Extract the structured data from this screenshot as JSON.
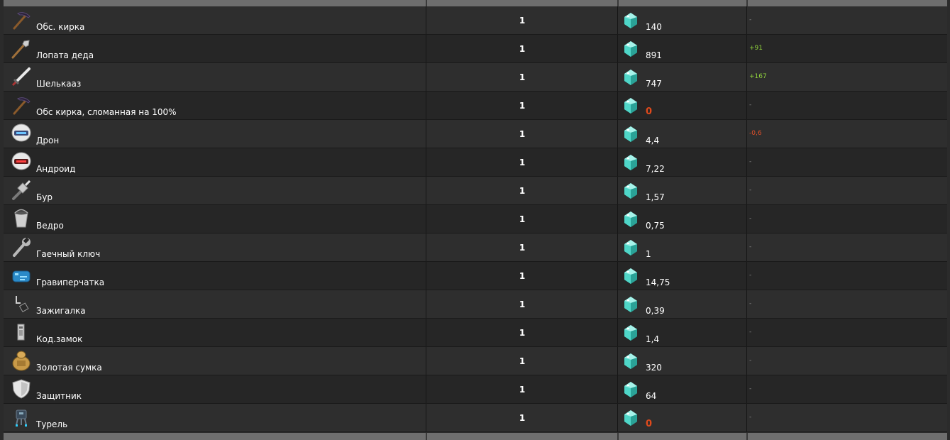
{
  "colors": {
    "positive": "#8fd13c",
    "negative": "#e0502a",
    "zero": "#e04a1c",
    "gem": "#4fd6c8"
  },
  "currency_icon": "diamond-icon",
  "items": [
    {
      "name": "Обс. кирка",
      "icon": "pickaxe-icon",
      "qty": "1",
      "price": "140",
      "change": "-",
      "change_type": "none"
    },
    {
      "name": "Лопата деда",
      "icon": "shovel-icon",
      "qty": "1",
      "price": "891",
      "change": "+91",
      "change_type": "up"
    },
    {
      "name": "Шелькааз",
      "icon": "sword-icon",
      "qty": "1",
      "price": "747",
      "change": "+167",
      "change_type": "up"
    },
    {
      "name": "Обс кирка, сломанная на 100%",
      "icon": "pickaxe-icon",
      "qty": "1",
      "price": "0",
      "change": "-",
      "change_type": "none"
    },
    {
      "name": "Дрон",
      "icon": "drone-icon",
      "qty": "1",
      "price": "4,4",
      "change": "-0,6",
      "change_type": "down"
    },
    {
      "name": "Андроид",
      "icon": "android-icon",
      "qty": "1",
      "price": "7,22",
      "change": "-",
      "change_type": "none"
    },
    {
      "name": "Бур",
      "icon": "drill-icon",
      "qty": "1",
      "price": "1,57",
      "change": "-",
      "change_type": "none"
    },
    {
      "name": "Ведро",
      "icon": "bucket-icon",
      "qty": "1",
      "price": "0,75",
      "change": "-",
      "change_type": "none"
    },
    {
      "name": "Гаечный ключ",
      "icon": "wrench-icon",
      "qty": "1",
      "price": "1",
      "change": "-",
      "change_type": "none"
    },
    {
      "name": "Гравиперчатка",
      "icon": "glove-icon",
      "qty": "1",
      "price": "14,75",
      "change": "-",
      "change_type": "none"
    },
    {
      "name": "Зажигалка",
      "icon": "lighter-icon",
      "qty": "1",
      "price": "0,39",
      "change": "-",
      "change_type": "none"
    },
    {
      "name": "Код.замок",
      "icon": "code-lock-icon",
      "qty": "1",
      "price": "1,4",
      "change": "-",
      "change_type": "none"
    },
    {
      "name": "Золотая сумка",
      "icon": "bag-icon",
      "qty": "1",
      "price": "320",
      "change": "-",
      "change_type": "none"
    },
    {
      "name": "Защитник",
      "icon": "shield-icon",
      "qty": "1",
      "price": "64",
      "change": "-",
      "change_type": "none"
    },
    {
      "name": "Турель",
      "icon": "turret-icon",
      "qty": "1",
      "price": "0",
      "change": "-",
      "change_type": "none"
    }
  ]
}
